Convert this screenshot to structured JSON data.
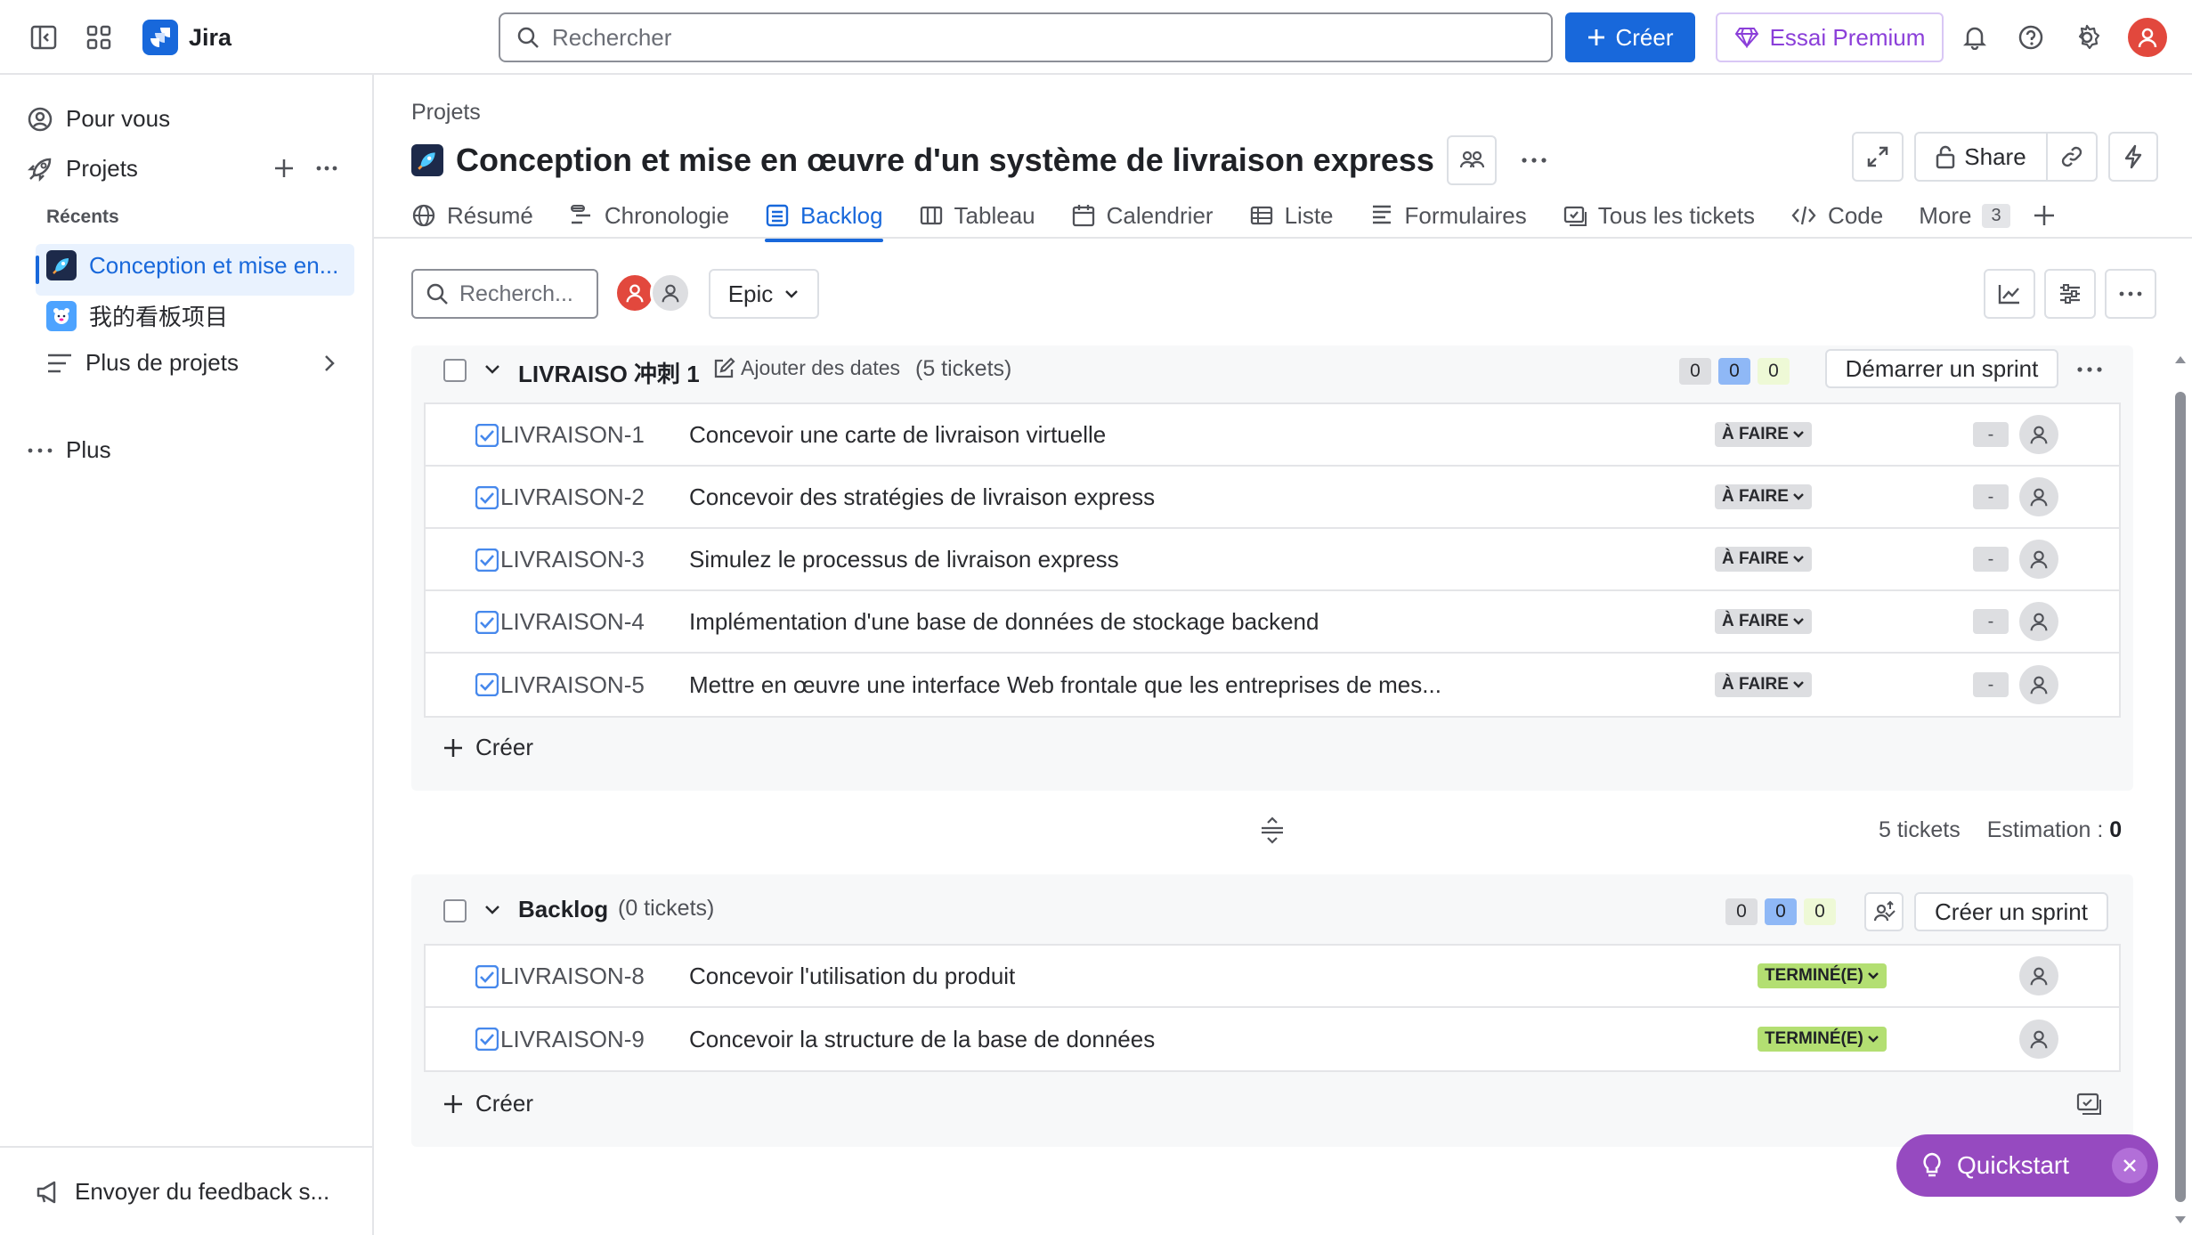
{
  "topbar": {
    "app_name": "Jira",
    "search_placeholder": "Rechercher",
    "create_label": "Créer",
    "premium_label": "Essai Premium"
  },
  "sidebar": {
    "for_you": "Pour vous",
    "projects": "Projets",
    "recent_heading": "Récents",
    "recent_projects": [
      {
        "label": "Conception et mise en..."
      },
      {
        "label": "我的看板项目"
      }
    ],
    "more_projects": "Plus de projets",
    "more": "Plus",
    "feedback": "Envoyer du feedback s..."
  },
  "header": {
    "breadcrumb": "Projets",
    "title": "Conception et mise en œuvre d'un système de livraison express",
    "share_label": "Share"
  },
  "tabs": [
    {
      "label": "Résumé",
      "icon": "globe-icon"
    },
    {
      "label": "Chronologie",
      "icon": "timeline-icon"
    },
    {
      "label": "Backlog",
      "icon": "backlog-icon",
      "active": true
    },
    {
      "label": "Tableau",
      "icon": "board-icon"
    },
    {
      "label": "Calendrier",
      "icon": "calendar-icon"
    },
    {
      "label": "Liste",
      "icon": "list-icon"
    },
    {
      "label": "Formulaires",
      "icon": "forms-icon"
    },
    {
      "label": "Tous les tickets",
      "icon": "issues-icon"
    },
    {
      "label": "Code",
      "icon": "code-icon"
    }
  ],
  "more_tab": {
    "label": "More",
    "count": "3"
  },
  "filters": {
    "search_placeholder": "Recherch...",
    "epic_label": "Epic"
  },
  "sprint": {
    "name": "LIVRAISO 冲刺 1",
    "add_dates": "Ajouter des dates",
    "ticket_count": "(5 tickets)",
    "estimates": [
      "0",
      "0",
      "0"
    ],
    "start_label": "Démarrer un sprint",
    "issues": [
      {
        "key": "LIVRAISON-1",
        "summary": "Concevoir une carte de livraison virtuelle",
        "status": "À FAIRE",
        "estimate": "-"
      },
      {
        "key": "LIVRAISON-2",
        "summary": "Concevoir des stratégies de livraison express",
        "status": "À FAIRE",
        "estimate": "-"
      },
      {
        "key": "LIVRAISON-3",
        "summary": "Simulez le processus de livraison express",
        "status": "À FAIRE",
        "estimate": "-"
      },
      {
        "key": "LIVRAISON-4",
        "summary": "Implémentation d'une base de données de stockage backend",
        "status": "À FAIRE",
        "estimate": "-"
      },
      {
        "key": "LIVRAISON-5",
        "summary": "Mettre en œuvre une interface Web frontale que les entreprises de mes...",
        "status": "À FAIRE",
        "estimate": "-"
      }
    ],
    "create_label": "Créer",
    "footer_tickets": "5 tickets",
    "footer_estimate_label": "Estimation : ",
    "footer_estimate_value": "0"
  },
  "backlog": {
    "name": "Backlog",
    "ticket_count": "(0 tickets)",
    "estimates": [
      "0",
      "0",
      "0"
    ],
    "create_sprint_label": "Créer un sprint",
    "issues": [
      {
        "key": "LIVRAISON-8",
        "summary": "Concevoir l'utilisation du produit",
        "status": "TERMINÉ(E)"
      },
      {
        "key": "LIVRAISON-9",
        "summary": "Concevoir la structure de la base de données",
        "status": "TERMINÉ(E)"
      }
    ],
    "create_label": "Créer"
  },
  "quickstart": {
    "label": "Quickstart"
  },
  "colors": {
    "brand": "#1868db",
    "premium": "#8b3fd9",
    "done_status": "#b3df72",
    "quickstart": "#964ac0"
  }
}
